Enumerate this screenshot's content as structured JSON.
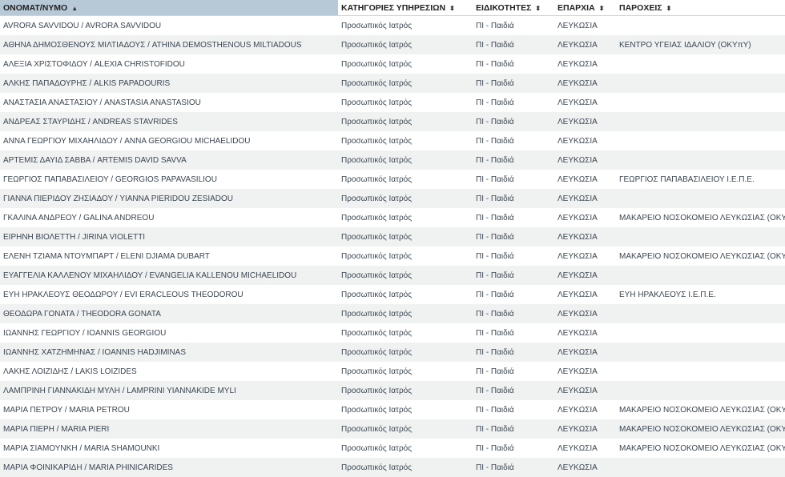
{
  "table": {
    "columns": [
      {
        "label": "ΟΝΟΜΑΤ/ΝΥΜΟ",
        "sort_icon": "▲"
      },
      {
        "label": "ΚΑΤΗΓΟΡΙΕΣ ΥΠΗΡΕΣΙΩΝ",
        "sort_icon": "⬍"
      },
      {
        "label": "ΕΙΔΙΚΟΤΗΤΕΣ",
        "sort_icon": "⬍"
      },
      {
        "label": "ΕΠΑΡΧΙΑ",
        "sort_icon": "⬍"
      },
      {
        "label": "ΠΑΡΟΧΕΙΣ",
        "sort_icon": "⬍"
      }
    ],
    "rows": [
      [
        "AVRORA SAVVIDOU / AVRORA SAVVIDOU",
        "Προσωπικός Ιατρός",
        "ΠΙ - Παιδιά",
        "ΛΕΥΚΩΣΙΑ",
        ""
      ],
      [
        "ΑΘΗΝΑ ΔΗΜΟΣΘΕΝΟΥΣ ΜΙΛΤΙΑΔΟΥΣ / ATHINA DEMOSTHENOUS MILTIADOUS",
        "Προσωπικός Ιατρός",
        "ΠΙ - Παιδιά",
        "ΛΕΥΚΩΣΙΑ",
        "ΚΕΝΤΡΟ ΥΓΕΙΑΣ ΙΔΑΛΙΟΥ (ΟΚΥπΥ)"
      ],
      [
        "ΑΛΕΞΙΑ ΧΡΙΣΤΟΦΙΔΟΥ / ALEXIA CHRISTOFIDOU",
        "Προσωπικός Ιατρός",
        "ΠΙ - Παιδιά",
        "ΛΕΥΚΩΣΙΑ",
        ""
      ],
      [
        "ΑΛΚΗΣ ΠΑΠΑΔΟΥΡΗΣ / ALKIS PAPADOURIS",
        "Προσωπικός Ιατρός",
        "ΠΙ - Παιδιά",
        "ΛΕΥΚΩΣΙΑ",
        ""
      ],
      [
        "ΑΝΑΣΤΑΣΙΑ ΑΝΑΣΤΑΣΙΟΥ / ANASTASIA ANASTASIOU",
        "Προσωπικός Ιατρός",
        "ΠΙ - Παιδιά",
        "ΛΕΥΚΩΣΙΑ",
        ""
      ],
      [
        "ΑΝΔΡΕΑΣ ΣΤΑΥΡΙΔΗΣ / ANDREAS STAVRIDES",
        "Προσωπικός Ιατρός",
        "ΠΙ - Παιδιά",
        "ΛΕΥΚΩΣΙΑ",
        ""
      ],
      [
        "ΑΝΝΑ ΓΕΩΡΓΙΟΥ ΜΙΧΑΗΛΙΔΟΥ / ANNA GEORGIOU MICHAELIDOU",
        "Προσωπικός Ιατρός",
        "ΠΙ - Παιδιά",
        "ΛΕΥΚΩΣΙΑ",
        ""
      ],
      [
        "ΑΡΤΕΜΙΣ ΔΑΥΙΔ ΣΑΒΒΑ / ARTEMIS DAVID SAVVA",
        "Προσωπικός Ιατρός",
        "ΠΙ - Παιδιά",
        "ΛΕΥΚΩΣΙΑ",
        ""
      ],
      [
        "ΓΕΩΡΓΙΟΣ ΠΑΠΑΒΑΣΙΛΕΙΟΥ / GEORGIOS PAPAVASILIOU",
        "Προσωπικός Ιατρός",
        "ΠΙ - Παιδιά",
        "ΛΕΥΚΩΣΙΑ",
        "ΓΕΩΡΓΙΟΣ ΠΑΠΑΒΑΣΙΛΕΙΟΥ Ι.Ε.Π.Ε."
      ],
      [
        "ΓΙΑΝΝΑ ΠΙΕΡΙΔΟΥ ΖΗΣΙΑΔΟΥ / YIANNA PIERIDOU ZESIADOU",
        "Προσωπικός Ιατρός",
        "ΠΙ - Παιδιά",
        "ΛΕΥΚΩΣΙΑ",
        ""
      ],
      [
        "ΓΚΑΛΙΝΑ ΑΝΔΡΕΟΥ / GALINA ANDREOU",
        "Προσωπικός Ιατρός",
        "ΠΙ - Παιδιά",
        "ΛΕΥΚΩΣΙΑ",
        "ΜΑΚΑΡΕΙΟ ΝΟΣΟΚΟΜΕΙΟ ΛΕΥΚΩΣΙΑΣ (ΟΚΥπΥ)"
      ],
      [
        "ΕΙΡΗΝΗ ΒΙΟΛΕΤΤΗ / JIRINA VIOLETTI",
        "Προσωπικός Ιατρός",
        "ΠΙ - Παιδιά",
        "ΛΕΥΚΩΣΙΑ",
        ""
      ],
      [
        "ΕΛΕΝΗ ΤΖΙΑΜΑ ΝΤΟΥΜΠΑΡΤ / ELENI DJIAMA DUBART",
        "Προσωπικός Ιατρός",
        "ΠΙ - Παιδιά",
        "ΛΕΥΚΩΣΙΑ",
        "ΜΑΚΑΡΕΙΟ ΝΟΣΟΚΟΜΕΙΟ ΛΕΥΚΩΣΙΑΣ (ΟΚΥπΥ)"
      ],
      [
        "ΕΥΑΓΓΕΛΙΑ ΚΑΛΛΕΝΟΥ ΜΙΧΑΗΛΙΔΟΥ / EVANGELIA KALLENOU MICHAELIDOU",
        "Προσωπικός Ιατρός",
        "ΠΙ - Παιδιά",
        "ΛΕΥΚΩΣΙΑ",
        ""
      ],
      [
        "ΕΥΗ ΗΡΑΚΛΕΟΥΣ ΘΕΟΔΩΡΟΥ / EVI ERACLEOUS THEODOROU",
        "Προσωπικός Ιατρός",
        "ΠΙ - Παιδιά",
        "ΛΕΥΚΩΣΙΑ",
        "ΕΥΗ ΗΡΑΚΛΕΟΥΣ Ι.Ε.Π.Ε."
      ],
      [
        "ΘΕΟΔΩΡΑ ΓΟΝΑΤΑ / THEODORA GONATA",
        "Προσωπικός Ιατρός",
        "ΠΙ - Παιδιά",
        "ΛΕΥΚΩΣΙΑ",
        ""
      ],
      [
        "ΙΩΑΝΝΗΣ ΓΕΩΡΓΙΟΥ / IOANNIS GEORGIOU",
        "Προσωπικός Ιατρός",
        "ΠΙ - Παιδιά",
        "ΛΕΥΚΩΣΙΑ",
        ""
      ],
      [
        "ΙΩΑΝΝΗΣ ΧΑΤΖΗΜΗΝΑΣ / IOANNIS HADJIMINAS",
        "Προσωπικός Ιατρός",
        "ΠΙ - Παιδιά",
        "ΛΕΥΚΩΣΙΑ",
        ""
      ],
      [
        "ΛΑΚΗΣ ΛΟΙΖΙΔΗΣ / LAKIS LOIZIDES",
        "Προσωπικός Ιατρός",
        "ΠΙ - Παιδιά",
        "ΛΕΥΚΩΣΙΑ",
        ""
      ],
      [
        "ΛΑΜΠΡΙΝΗ ΓΙΑΝΝΑΚΙΔΗ ΜΥΛΗ / LAMPRINI YIANNAKIDE MYLI",
        "Προσωπικός Ιατρός",
        "ΠΙ - Παιδιά",
        "ΛΕΥΚΩΣΙΑ",
        ""
      ],
      [
        "ΜΑΡΙΑ ΠΕΤΡΟΥ / MARIA PETROU",
        "Προσωπικός Ιατρός",
        "ΠΙ - Παιδιά",
        "ΛΕΥΚΩΣΙΑ",
        "ΜΑΚΑΡΕΙΟ ΝΟΣΟΚΟΜΕΙΟ ΛΕΥΚΩΣΙΑΣ (ΟΚΥπΥ)"
      ],
      [
        "ΜΑΡΙΑ ΠΙΕΡΗ / MARIA PIERI",
        "Προσωπικός Ιατρός",
        "ΠΙ - Παιδιά",
        "ΛΕΥΚΩΣΙΑ",
        "ΜΑΚΑΡΕΙΟ ΝΟΣΟΚΟΜΕΙΟ ΛΕΥΚΩΣΙΑΣ (ΟΚΥπΥ)"
      ],
      [
        "ΜΑΡΙΑ ΣΙΑΜΟΥΝΚΗ / MARIA SHAMOUNKI",
        "Προσωπικός Ιατρός",
        "ΠΙ - Παιδιά",
        "ΛΕΥΚΩΣΙΑ",
        "ΜΑΚΑΡΕΙΟ ΝΟΣΟΚΟΜΕΙΟ ΛΕΥΚΩΣΙΑΣ (ΟΚΥπΥ)"
      ],
      [
        "ΜΑΡΙΑ ΦΟΙΝΙΚΑΡΙΔΗ / MARIA PHINICARIDES",
        "Προσωπικός Ιατρός",
        "ΠΙ - Παιδιά",
        "ΛΕΥΚΩΣΙΑ",
        ""
      ]
    ]
  }
}
